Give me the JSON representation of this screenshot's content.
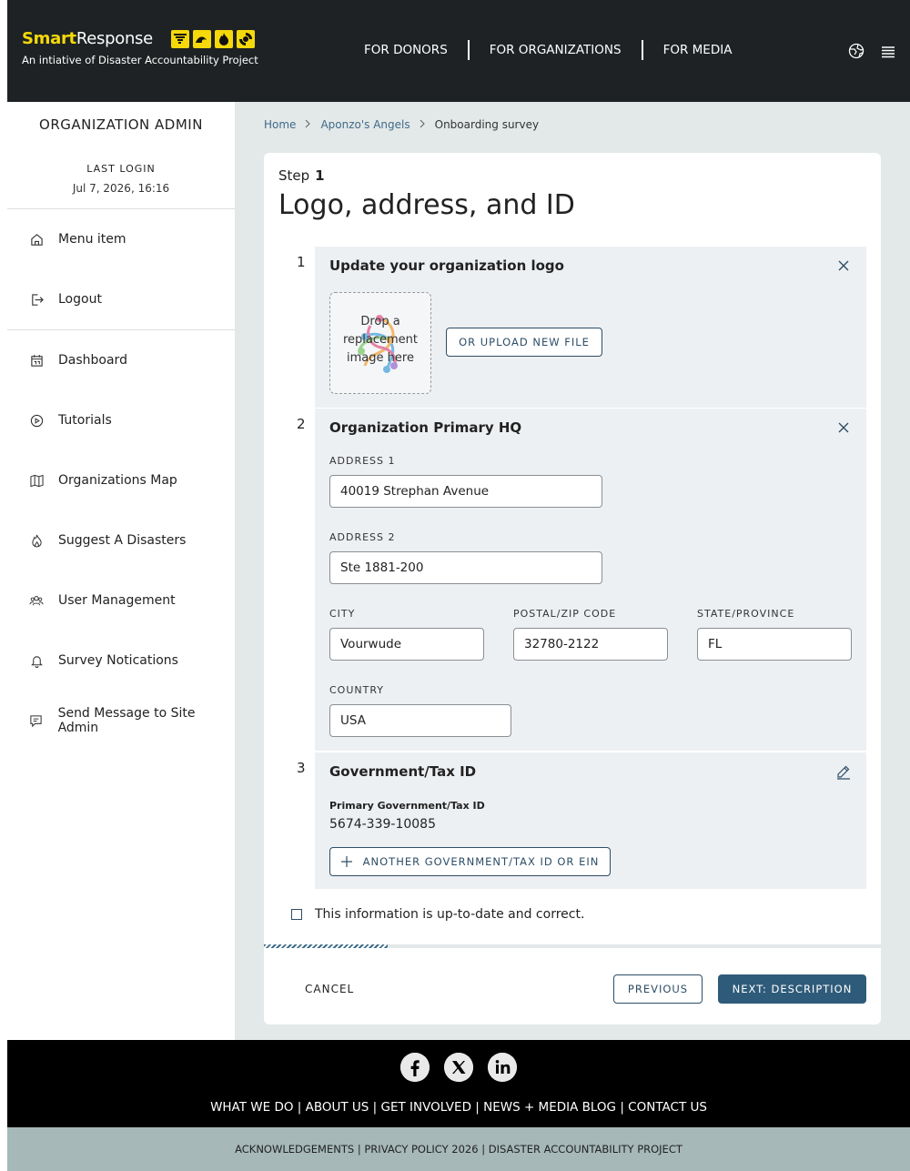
{
  "header": {
    "brand_smart": "Smart",
    "brand_response": "Response",
    "tagline": "An intiative of Disaster Accountability Project",
    "hazard_icons": [
      "tornado-icon",
      "wave-icon",
      "fire-icon",
      "storm-icon"
    ],
    "nav": [
      "FOR DONORS",
      "FOR ORGANIZATIONS",
      "FOR MEDIA"
    ],
    "icons": [
      "globe-icon",
      "hamburger-menu-icon"
    ]
  },
  "sidebar": {
    "title": "ORGANIZATION ADMIN",
    "last_login_label": "LAST LOGIN",
    "last_login_value": "Jul 7, 2026, 16:16",
    "items": [
      {
        "label": "Menu item",
        "icon": "home-icon"
      },
      {
        "label": "Logout",
        "icon": "logout-icon"
      },
      {
        "label": "Dashboard",
        "icon": "calendar-icon"
      },
      {
        "label": "Tutorials",
        "icon": "play-icon"
      },
      {
        "label": "Organizations Map",
        "icon": "map-icon"
      },
      {
        "label": "Suggest A Disasters",
        "icon": "fire-icon"
      },
      {
        "label": "User Management",
        "icon": "users-icon"
      },
      {
        "label": "Survey Notications",
        "icon": "bell-icon"
      },
      {
        "label": "Send Message to Site Admin",
        "icon": "message-icon"
      }
    ]
  },
  "breadcrumb": {
    "items": [
      "Home",
      "Aponzo's Angels"
    ],
    "current": "Onboarding survey"
  },
  "form": {
    "step_label": "Step",
    "step_number": "1",
    "title": "Logo, address, and ID",
    "sections": [
      {
        "number": "1",
        "title": "Update your organization logo"
      },
      {
        "number": "2",
        "title": "Organization Primary HQ"
      },
      {
        "number": "3",
        "title": "Government/Tax ID"
      }
    ],
    "logo": {
      "drop_text": "Drop a replacement image here",
      "upload_button": "OR UPLOAD NEW FILE"
    },
    "address": {
      "address1_label": "ADDRESS 1",
      "address1_value": "40019 Strephan Avenue",
      "address2_label": "ADDRESS 2",
      "address2_value": "Ste 1881-200",
      "city_label": "CITY",
      "city_value": "Vourwude",
      "zip_label": "POSTAL/ZIP CODE",
      "zip_value": "32780-2122",
      "state_label": "STATE/PROVINCE",
      "state_value": "FL",
      "country_label": "COUNTRY",
      "country_value": "USA"
    },
    "tax": {
      "primary_label": "Primary Government/Tax ID",
      "primary_value": "5674-339-10085",
      "add_button": "ANOTHER GOVERNMENT/TAX ID OR EIN"
    },
    "confirm_label": "This information is up-to-date and correct.",
    "progress_fraction": 0.2,
    "cancel_label": "CANCEL",
    "previous_label": "PREVIOUS",
    "next_label": "NEXT: DESCRIPTION"
  },
  "footer": {
    "social": [
      "facebook-icon",
      "x-icon",
      "linkedin-icon"
    ],
    "links": [
      "WHAT WE DO",
      "ABOUT US",
      "GET INVOLVED",
      "NEWS + MEDIA BLOG",
      "CONTACT US"
    ],
    "sub_links": [
      "ACKNOWLEDGEMENTS",
      "PRIVACY POLICY 2026",
      "DISASTER ACCOUNTABILITY PROJECT"
    ]
  },
  "colors": {
    "brand_yellow": "#f5d90a",
    "header_bg": "#1e2224",
    "primary_button": "#2f5b7a",
    "main_bg": "#e3e8e8",
    "section_bg": "#edf0f3",
    "subfooter_bg": "#a6b8b8"
  }
}
